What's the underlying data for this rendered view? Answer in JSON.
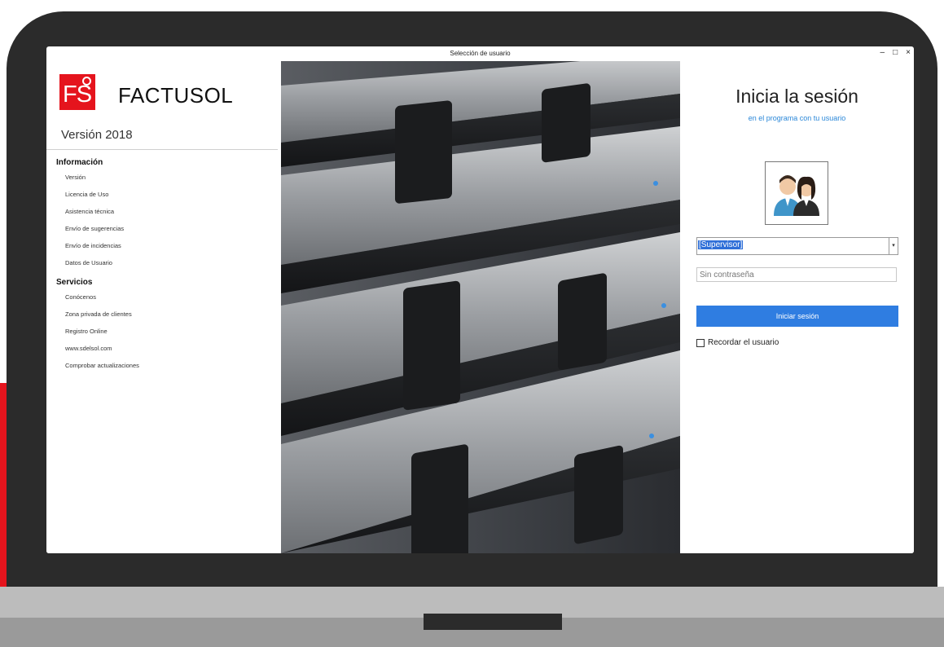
{
  "window": {
    "title": "Selección de usuario",
    "controls": {
      "minimize": "–",
      "maximize": "□",
      "close": "×"
    }
  },
  "brand": {
    "logo_text": "FS",
    "app_name": "FACTUSOL",
    "version": "Versión 2018",
    "accent_color": "#e5141d"
  },
  "sidebar": {
    "sections": [
      {
        "title": "Información",
        "items": [
          "Versión",
          "Licencia de Uso",
          "Asistencia técnica",
          "Envío de sugerencias",
          "Envío de incidencias",
          "Datos de Usuario"
        ]
      },
      {
        "title": "Servicios",
        "items": [
          "Conócenos",
          "Zona privada de clientes",
          "Registro Online",
          "www.sdelsol.com",
          "Comprobar actualizaciones"
        ]
      }
    ]
  },
  "login": {
    "title": "Inicia la sesión",
    "subtitle": "en el programa con tu usuario",
    "user_selected": "[Supervisor]",
    "password_placeholder": "Sin contraseña",
    "button_label": "Iniciar sesión",
    "remember_label": "Recordar el usuario",
    "button_color": "#2f7de1",
    "subtitle_color": "#2a87d8"
  }
}
